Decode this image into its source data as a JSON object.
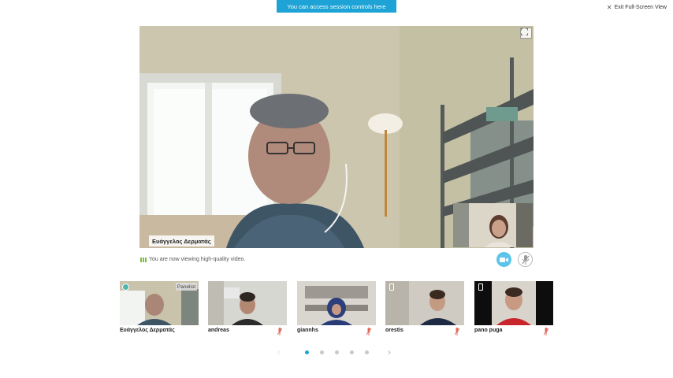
{
  "banner": {
    "text": "You can access session controls here"
  },
  "exit_fullscreen": {
    "label": "Exit Full-Screen View",
    "icon": "close-icon"
  },
  "main_video": {
    "speaker_name": "Ευάγγελος Δερματάς",
    "expand_icon": "expand-icon"
  },
  "quality_status": {
    "text": "You are now viewing high-quality video."
  },
  "controls": {
    "camera_icon": "camera-icon",
    "camera_color": "#5bc4e8",
    "mic_icon": "mic-muted-icon"
  },
  "participants": [
    {
      "name": "Ευάγγελος Δερματάς",
      "tag": "Panelist",
      "badge": "status-dot"
    },
    {
      "name": "andreas",
      "muted": true
    },
    {
      "name": "giannhs",
      "muted": true
    },
    {
      "name": "orestis",
      "muted": true,
      "badge": "phone-icon"
    },
    {
      "name": "pano puga",
      "muted": true,
      "badge": "phone-icon"
    }
  ],
  "pagination": {
    "pages": 5,
    "current": 1,
    "accent": "#1ea3d6"
  }
}
